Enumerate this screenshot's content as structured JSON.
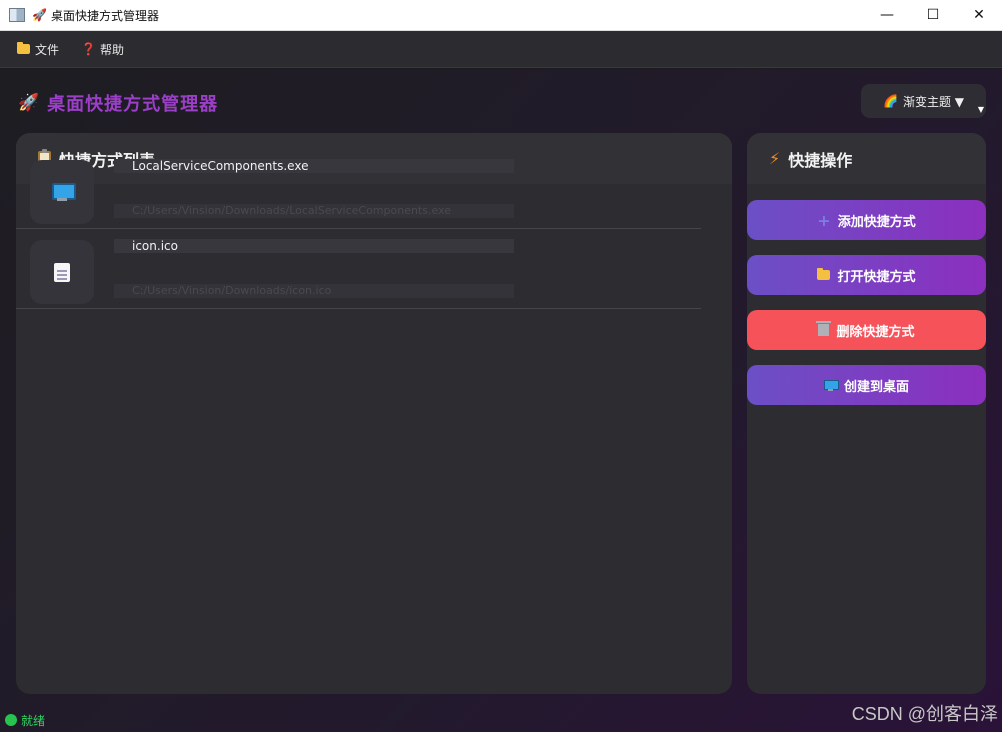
{
  "window": {
    "title_emoji": "🚀",
    "title": "桌面快捷方式管理器",
    "minimize": "—",
    "maximize": "☐",
    "close": "✕"
  },
  "menu": {
    "file": "文件",
    "help_icon": "❓",
    "help": "帮助"
  },
  "header": {
    "rocket": "🚀",
    "title": "桌面快捷方式管理器",
    "theme_icon": "🌈",
    "theme_label": "渐变主题 ▼",
    "theme_dropdown": "▼"
  },
  "list_panel": {
    "title": "快捷方式列表",
    "items": [
      {
        "name": "LocalServiceComponents.exe",
        "path": "C:/Users/Vinsion/Downloads/LocalServiceComponents.exe",
        "icon": "monitor-icon"
      },
      {
        "name": "icon.ico",
        "path": "C:/Users/Vinsion/Downloads/icon.ico",
        "icon": "document-icon"
      }
    ]
  },
  "actions_panel": {
    "bolt": "⚡",
    "title": "快捷操作",
    "add": "添加快捷方式",
    "add_icon": "+",
    "open": "打开快捷方式",
    "delete": "删除快捷方式",
    "create": "创建到桌面"
  },
  "status": {
    "text": "就绪",
    "color": "#26c34f"
  },
  "watermark": "CSDN @创客白泽",
  "colors": {
    "accent_purple": "#9b3fc8",
    "button_gradient_start": "#6b4fc6",
    "button_gradient_end": "#8c2fbf",
    "danger": "#f5525a"
  }
}
